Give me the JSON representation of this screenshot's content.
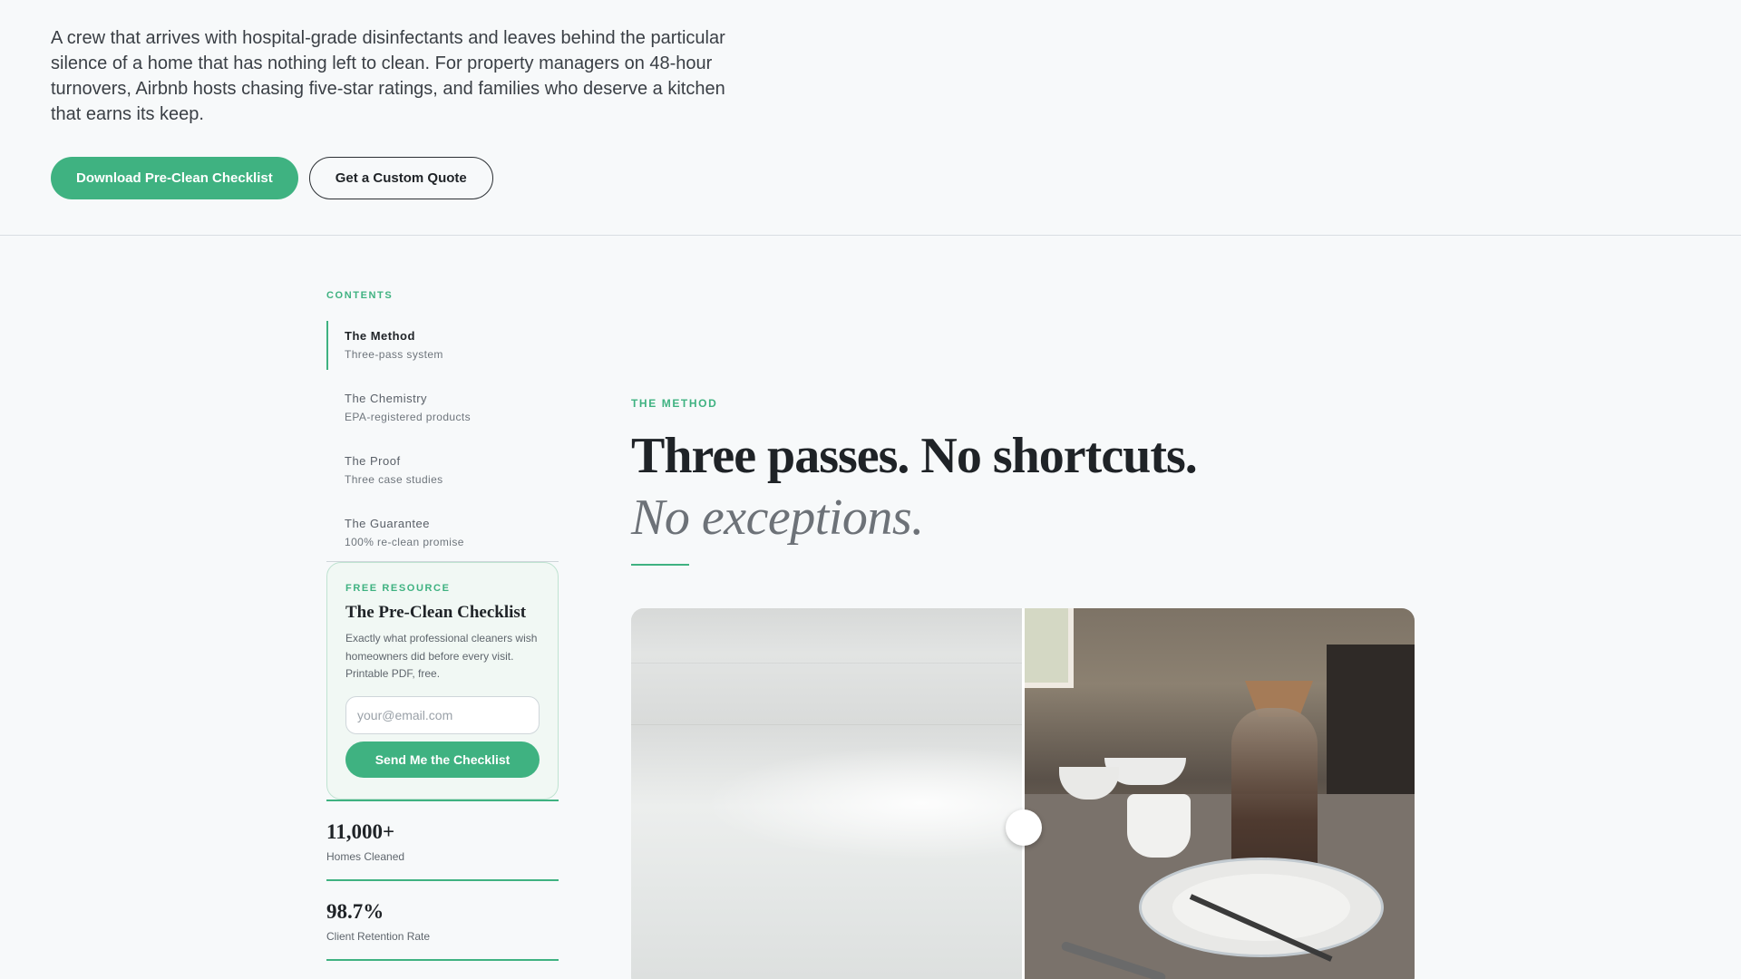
{
  "hero": {
    "description": "A crew that arrives with hospital-grade disinfectants and leaves behind the particular silence of a home that has nothing left to clean. For property managers on 48-hour turnovers, Airbnb hosts chasing five-star ratings, and families who deserve a kitchen that earns its keep.",
    "primary_cta": "Download Pre-Clean Checklist",
    "secondary_cta": "Get a Custom Quote"
  },
  "sidebar": {
    "contents_label": "CONTENTS",
    "toc": [
      {
        "title": "The Method",
        "subtitle": "Three-pass system",
        "active": true
      },
      {
        "title": "The Chemistry",
        "subtitle": "EPA-registered products",
        "active": false
      },
      {
        "title": "The Proof",
        "subtitle": "Three case studies",
        "active": false
      },
      {
        "title": "The Guarantee",
        "subtitle": "100% re-clean promise",
        "active": false
      }
    ],
    "resource": {
      "eyebrow": "FREE RESOURCE",
      "title": "The Pre-Clean Checklist",
      "description": "Exactly what professional cleaners wish homeowners did before every visit. Printable PDF, free.",
      "email_placeholder": "your@email.com",
      "email_value": "",
      "button": "Send Me the Checklist"
    },
    "stats": [
      {
        "value": "11,000+",
        "label": "Homes Cleaned"
      },
      {
        "value": "98.7%",
        "label": "Client Retention Rate"
      }
    ]
  },
  "main": {
    "eyebrow": "THE METHOD",
    "headline": "Three passes. No shortcuts.",
    "subheadline": "No exceptions.",
    "comparison": {
      "slider_position": 0.5
    }
  },
  "colors": {
    "accent": "#3fb281",
    "background": "#f7f9fa",
    "text": "#1f2327"
  }
}
